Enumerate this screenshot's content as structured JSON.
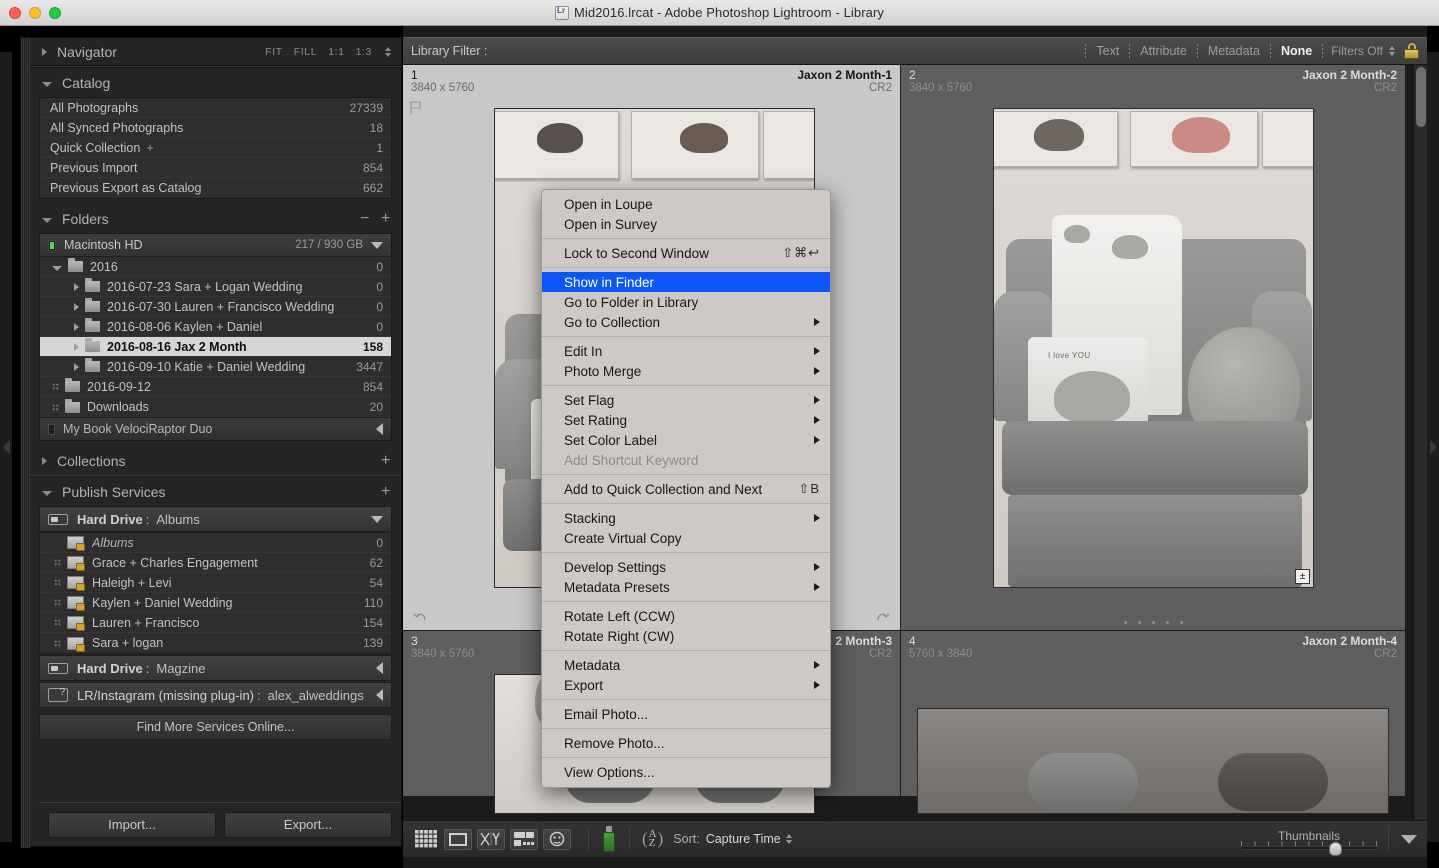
{
  "window": {
    "title": "Mid2016.lrcat - Adobe Photoshop Lightroom - Library",
    "app_icon": "lightroom-icon"
  },
  "left_panel": {
    "navigator": {
      "title": "Navigator",
      "zoom_options": [
        "FIT",
        "FILL",
        "1:1",
        "1:3"
      ]
    },
    "catalog": {
      "title": "Catalog",
      "items": [
        {
          "label": "All Photographs",
          "count": "27339"
        },
        {
          "label": "All Synced Photographs",
          "count": "18"
        },
        {
          "label": "Quick Collection",
          "plus": "+",
          "count": "1"
        },
        {
          "label": "Previous Import",
          "count": "854"
        },
        {
          "label": "Previous Export as Catalog",
          "count": "662"
        }
      ]
    },
    "folders": {
      "title": "Folders",
      "drive": {
        "name": "Macintosh HD",
        "capacity": "217 / 930 GB"
      },
      "tree": [
        {
          "label": "2016",
          "count": "0",
          "depth": 0,
          "twisty": "open",
          "selected": false
        },
        {
          "label": "2016-07-23 Sara + Logan Wedding",
          "count": "0",
          "depth": 1,
          "twisty": "closed",
          "selected": false
        },
        {
          "label": "2016-07-30 Lauren + Francisco Wedding",
          "count": "0",
          "depth": 1,
          "twisty": "closed",
          "selected": false
        },
        {
          "label": "2016-08-06 Kaylen + Daniel",
          "count": "0",
          "depth": 1,
          "twisty": "closed",
          "selected": false
        },
        {
          "label": "2016-08-16 Jax 2 Month",
          "count": "158",
          "depth": 1,
          "twisty": "closed",
          "selected": true
        },
        {
          "label": "2016-09-10 Katie + Daniel Wedding",
          "count": "3447",
          "depth": 1,
          "twisty": "closed",
          "selected": false
        },
        {
          "label": "2016-09-12",
          "count": "854",
          "depth": 0,
          "twisty": "dots",
          "selected": false
        },
        {
          "label": "Downloads",
          "count": "20",
          "depth": 0,
          "twisty": "dots",
          "selected": false
        }
      ],
      "drive2": {
        "name": "My Book VelociRaptor Duo"
      }
    },
    "collections": {
      "title": "Collections"
    },
    "publish_services": {
      "title": "Publish Services",
      "service1": {
        "type": "Hard Drive",
        "name": "Albums"
      },
      "collections": [
        {
          "label": "Albums",
          "count": "0",
          "italic": true
        },
        {
          "label": "Grace + Charles Engagement",
          "count": "62",
          "italic": false
        },
        {
          "label": "Haleigh + Levi",
          "count": "54",
          "italic": false
        },
        {
          "label": "Kaylen + Daniel Wedding",
          "count": "110",
          "italic": false
        },
        {
          "label": "Lauren + Francisco",
          "count": "154",
          "italic": false
        },
        {
          "label": "Sara + logan",
          "count": "139",
          "italic": false
        }
      ],
      "service2": {
        "type": "Hard Drive",
        "name": "Magzine"
      },
      "service3": {
        "type": "LR/Instagram (missing plug-in)",
        "name": "alex_alweddings"
      },
      "find_more": "Find More Services Online..."
    },
    "buttons": {
      "import": "Import...",
      "export": "Export..."
    }
  },
  "filter_bar": {
    "label": "Library Filter :",
    "items": [
      "Text",
      "Attribute",
      "Metadata",
      "None"
    ],
    "active": "None",
    "filters_state": "Filters Off",
    "lock_icon": "lock-icon"
  },
  "grid": {
    "cells": [
      {
        "index": "1",
        "name": "Jaxon 2 Month-1",
        "dimensions": "3840 x 5760",
        "filetype": "CR2",
        "selected": true
      },
      {
        "index": "2",
        "name": "Jaxon 2 Month-2",
        "dimensions": "3840 x 5760",
        "filetype": "CR2",
        "selected": false
      },
      {
        "index": "3",
        "name": "Jaxon 2 Month-3",
        "dimensions": "3840 x 5760",
        "filetype": "CR2",
        "selected": false
      },
      {
        "index": "4",
        "name": "Jaxon 2 Month-4",
        "dimensions": "5760 x 3840",
        "filetype": "CR2",
        "selected": false
      }
    ],
    "pillow_text": "I love YOU"
  },
  "context_menu": {
    "highlighted": "Show in Finder",
    "groups": [
      [
        {
          "label": "Open in Loupe",
          "shortcut": "",
          "submenu": false,
          "disabled": false
        },
        {
          "label": "Open in Survey",
          "shortcut": "",
          "submenu": false,
          "disabled": false
        }
      ],
      [
        {
          "label": "Lock to Second Window",
          "shortcut": "⇧⌘↩",
          "submenu": false,
          "disabled": false
        }
      ],
      [
        {
          "label": "Show in Finder",
          "shortcut": "",
          "submenu": false,
          "disabled": false
        },
        {
          "label": "Go to Folder in Library",
          "shortcut": "",
          "submenu": false,
          "disabled": false
        },
        {
          "label": "Go to Collection",
          "shortcut": "",
          "submenu": true,
          "disabled": false
        }
      ],
      [
        {
          "label": "Edit In",
          "shortcut": "",
          "submenu": true,
          "disabled": false
        },
        {
          "label": "Photo Merge",
          "shortcut": "",
          "submenu": true,
          "disabled": false
        }
      ],
      [
        {
          "label": "Set Flag",
          "shortcut": "",
          "submenu": true,
          "disabled": false
        },
        {
          "label": "Set Rating",
          "shortcut": "",
          "submenu": true,
          "disabled": false
        },
        {
          "label": "Set Color Label",
          "shortcut": "",
          "submenu": true,
          "disabled": false
        },
        {
          "label": "Add Shortcut Keyword",
          "shortcut": "",
          "submenu": false,
          "disabled": true
        }
      ],
      [
        {
          "label": "Add to Quick Collection and Next",
          "shortcut": "⇧B",
          "submenu": false,
          "disabled": false
        }
      ],
      [
        {
          "label": "Stacking",
          "shortcut": "",
          "submenu": true,
          "disabled": false
        },
        {
          "label": "Create Virtual Copy",
          "shortcut": "",
          "submenu": false,
          "disabled": false
        }
      ],
      [
        {
          "label": "Develop Settings",
          "shortcut": "",
          "submenu": true,
          "disabled": false
        },
        {
          "label": "Metadata Presets",
          "shortcut": "",
          "submenu": true,
          "disabled": false
        }
      ],
      [
        {
          "label": "Rotate Left (CCW)",
          "shortcut": "",
          "submenu": false,
          "disabled": false
        },
        {
          "label": "Rotate Right (CW)",
          "shortcut": "",
          "submenu": false,
          "disabled": false
        }
      ],
      [
        {
          "label": "Metadata",
          "shortcut": "",
          "submenu": true,
          "disabled": false
        },
        {
          "label": "Export",
          "shortcut": "",
          "submenu": true,
          "disabled": false
        }
      ],
      [
        {
          "label": "Email Photo...",
          "shortcut": "",
          "submenu": false,
          "disabled": false
        }
      ],
      [
        {
          "label": "Remove Photo...",
          "shortcut": "",
          "submenu": false,
          "disabled": false
        }
      ],
      [
        {
          "label": "View Options...",
          "shortcut": "",
          "submenu": false,
          "disabled": false
        }
      ]
    ]
  },
  "toolbar": {
    "view_icons": [
      "grid-view-icon",
      "loupe-view-icon",
      "compare-view-icon",
      "survey-view-icon",
      "people-view-icon"
    ],
    "spray_icon": "spray-can-icon",
    "sort_icon": "az-sort-icon",
    "sort_label": "Sort:",
    "sort_value": "Capture Time",
    "thumbnails_label": "Thumbnails",
    "thumbnails_value": 64,
    "panel_toggle_icon": "chevron-down-icon"
  },
  "colors": {
    "accent_blue": "#0b56f5",
    "panel_bg": "#252525",
    "grid_bg": "#5e5e5e",
    "selected_cell_bg": "#c8c8c8",
    "menu_bg": "#ccc9c6"
  }
}
